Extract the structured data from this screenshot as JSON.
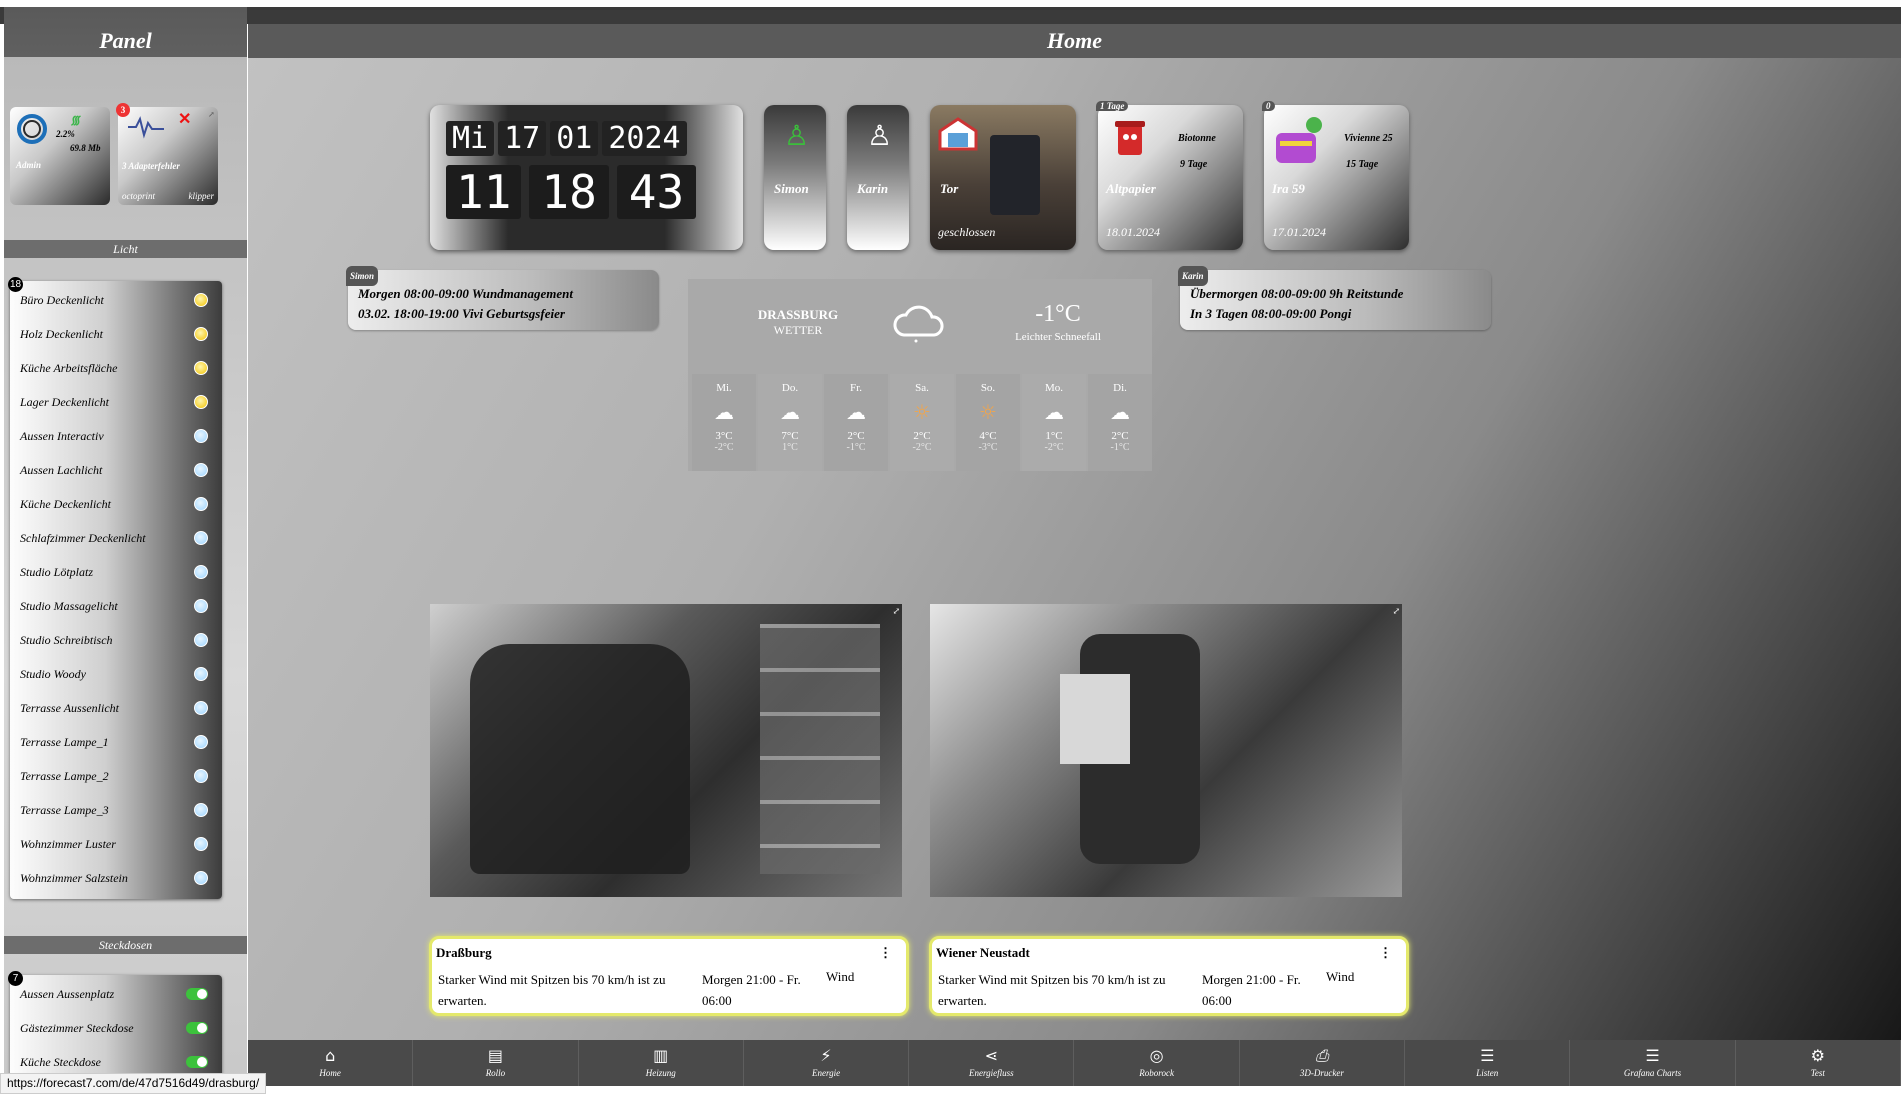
{
  "panel": {
    "title": "Panel",
    "admin": {
      "label": "Admin",
      "cpu": "2.2%",
      "mem": "69.8 Mb"
    },
    "adapter": {
      "badge": "3",
      "label": "3 Adapterfehler",
      "left": "octoprint",
      "right": "klipper"
    },
    "licht": {
      "header": "Licht",
      "count": "18",
      "items": [
        {
          "label": "Büro Deckenlicht",
          "on": true
        },
        {
          "label": "Holz Deckenlicht",
          "on": true
        },
        {
          "label": "Küche Arbeitsfläche",
          "on": true
        },
        {
          "label": "Lager Deckenlicht",
          "on": true
        },
        {
          "label": "Aussen Interactiv",
          "on": false
        },
        {
          "label": "Aussen Lachlicht",
          "on": false
        },
        {
          "label": "Küche Deckenlicht",
          "on": false
        },
        {
          "label": "Schlafzimmer Deckenlicht",
          "on": false
        },
        {
          "label": "Studio Lötplatz",
          "on": false
        },
        {
          "label": "Studio Massagelicht",
          "on": false
        },
        {
          "label": "Studio Schreibtisch",
          "on": false
        },
        {
          "label": "Studio Woody",
          "on": false
        },
        {
          "label": "Terrasse Aussenlicht",
          "on": false
        },
        {
          "label": "Terrasse Lampe_1",
          "on": false
        },
        {
          "label": "Terrasse Lampe_2",
          "on": false
        },
        {
          "label": "Terrasse Lampe_3",
          "on": false
        },
        {
          "label": "Wohnzimmer Luster",
          "on": false
        },
        {
          "label": "Wohnzimmer Salzstein",
          "on": false
        }
      ]
    },
    "steckdosen": {
      "header": "Steckdosen",
      "count": "7",
      "items": [
        {
          "label": "Aussen Aussenplatz"
        },
        {
          "label": "Gästezimmer Steckdose"
        },
        {
          "label": "Küche Steckdose"
        }
      ]
    }
  },
  "main": {
    "title": "Home",
    "clock": {
      "weekday": "Mi",
      "day": "17",
      "month": "01",
      "year": "2024",
      "hour": "11",
      "minute": "18",
      "second": "43"
    },
    "persons": [
      {
        "name": "Simon"
      },
      {
        "name": "Karin"
      }
    ],
    "gate": {
      "label": "Tor",
      "status": "geschlossen"
    },
    "waste": {
      "tag": "1 Tage",
      "name": "Altpapier",
      "next_name": "Biotonne",
      "next_days": "9 Tage",
      "date": "18.01.2024"
    },
    "birthday": {
      "tag": "0",
      "name": "Ira 59",
      "next_name": "Vivienne 25",
      "next_days": "15 Tage",
      "date": "17.01.2024"
    },
    "calendar_simon": {
      "tag": "Simon",
      "line1": "Morgen 08:00-09:00 Wundmanagement",
      "line2": "03.02. 18:00-19:00 Vivi Geburtsgsfeier"
    },
    "calendar_karin": {
      "tag": "Karin",
      "line1": "Übermorgen 08:00-09:00 9h Reitstunde",
      "line2": "In 3 Tagen 08:00-09:00 Pongi"
    },
    "weather": {
      "city": "DRASSBURG",
      "label": "WETTER",
      "temp": "-1°C",
      "desc": "Leichter Schneefall",
      "days": [
        {
          "day": "Mi.",
          "icon": "cloud",
          "hi": "3°C",
          "lo": "-2°C"
        },
        {
          "day": "Do.",
          "icon": "cloud",
          "hi": "7°C",
          "lo": "1°C"
        },
        {
          "day": "Fr.",
          "icon": "cloud",
          "hi": "2°C",
          "lo": "-1°C"
        },
        {
          "day": "Sa.",
          "icon": "sun",
          "hi": "2°C",
          "lo": "-2°C"
        },
        {
          "day": "So.",
          "icon": "sun",
          "hi": "4°C",
          "lo": "-3°C"
        },
        {
          "day": "Mo.",
          "icon": "cloud",
          "hi": "1°C",
          "lo": "-2°C"
        },
        {
          "day": "Di.",
          "icon": "cloud",
          "hi": "2°C",
          "lo": "-1°C"
        }
      ]
    },
    "alerts": [
      {
        "title": "Draßburg",
        "desc": "Starker Wind mit Spitzen bis 70 km/h ist zu erwarten.",
        "when": "Morgen 21:00 - Fr. 06:00",
        "kind": "Wind"
      },
      {
        "title": "Wiener Neustadt",
        "desc": "Starker Wind mit Spitzen bis 70 km/h ist zu erwarten.",
        "when": "Morgen 21:00 - Fr. 06:00",
        "kind": "Wind"
      }
    ]
  },
  "nav": [
    {
      "label": "Home",
      "icon": "home-icon"
    },
    {
      "label": "Rollo",
      "icon": "blind-icon"
    },
    {
      "label": "Heizung",
      "icon": "radiator-icon"
    },
    {
      "label": "Energie",
      "icon": "energy-icon"
    },
    {
      "label": "Energiefluss",
      "icon": "flow-icon"
    },
    {
      "label": "Roborock",
      "icon": "robot-icon"
    },
    {
      "label": "3D-Drucker",
      "icon": "printer-icon"
    },
    {
      "label": "Listen",
      "icon": "list-icon"
    },
    {
      "label": "Grafana Charts",
      "icon": "chart-list-icon"
    },
    {
      "label": "Test",
      "icon": "gear-icon"
    }
  ],
  "status_url": "https://forecast7.com/de/47d7516d49/drasburg/"
}
